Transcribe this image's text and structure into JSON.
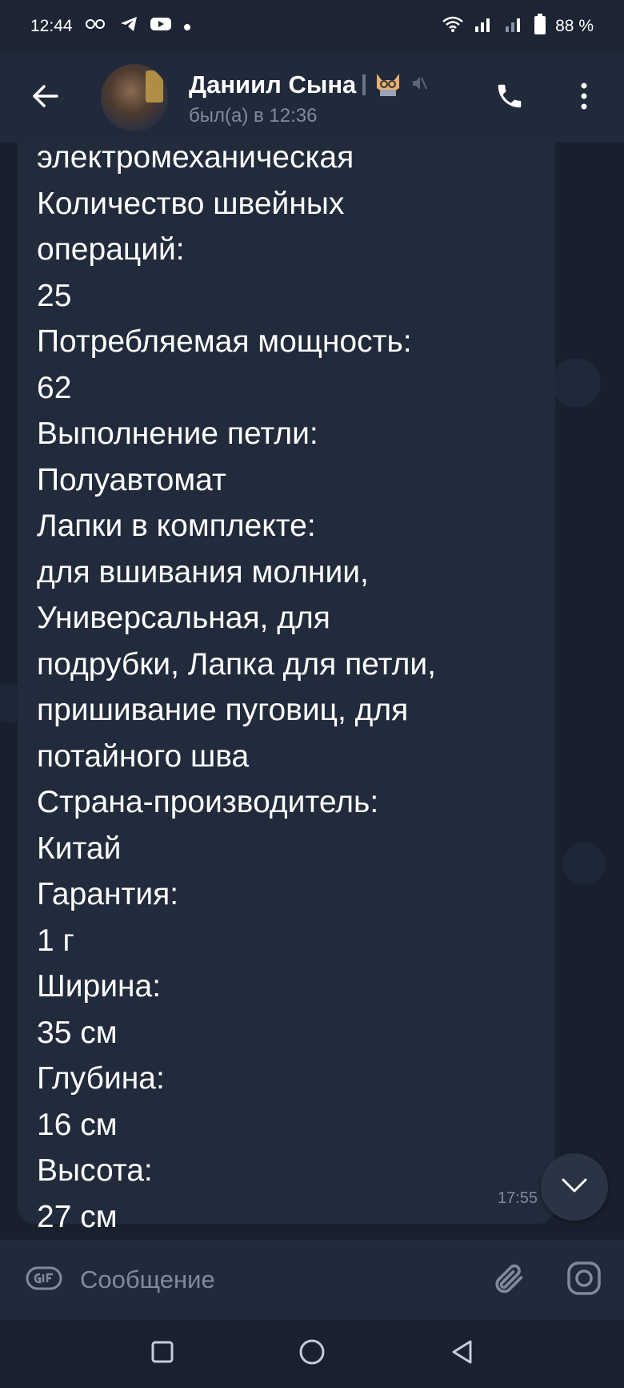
{
  "status_bar": {
    "time": "12:44",
    "battery": "88 %",
    "icons": [
      "vpn-key-icon",
      "telegram-icon",
      "youtube-icon",
      "dot-icon",
      "wifi-icon",
      "signal-icon",
      "signal-icon",
      "battery-icon"
    ]
  },
  "header": {
    "title": "Даниил Сына",
    "subtitle": "был(а) в 12:36",
    "icons": [
      "back-arrow-icon",
      "cat-emoji-icon",
      "muted-icon",
      "phone-icon",
      "more-vert-icon"
    ]
  },
  "message": {
    "text": "электромеханическая\nКоличество швейных\nопераций:\n25\nПотребляемая мощность:\n62\nВыполнение петли:\nПолуавтомат\nЛапки в комплекте:\nдля вшивания молнии,\nУниверсальная, для\nподрубки, Лапка для петли,\nпришивание пуговиц, для\nпотайного шва\nСтрана-производитель:\nКитай\nГарантия:\n1 г\nШирина:\n35 см\nГлубина:\n16 см\nВысота:\n27 см",
    "time": "17:55"
  },
  "input": {
    "placeholder": "Сообщение",
    "value": ""
  },
  "colors": {
    "background": "#19202d",
    "header": "#212a3a",
    "bubble": "#222b3b",
    "muted_text": "#7f8a9e"
  }
}
